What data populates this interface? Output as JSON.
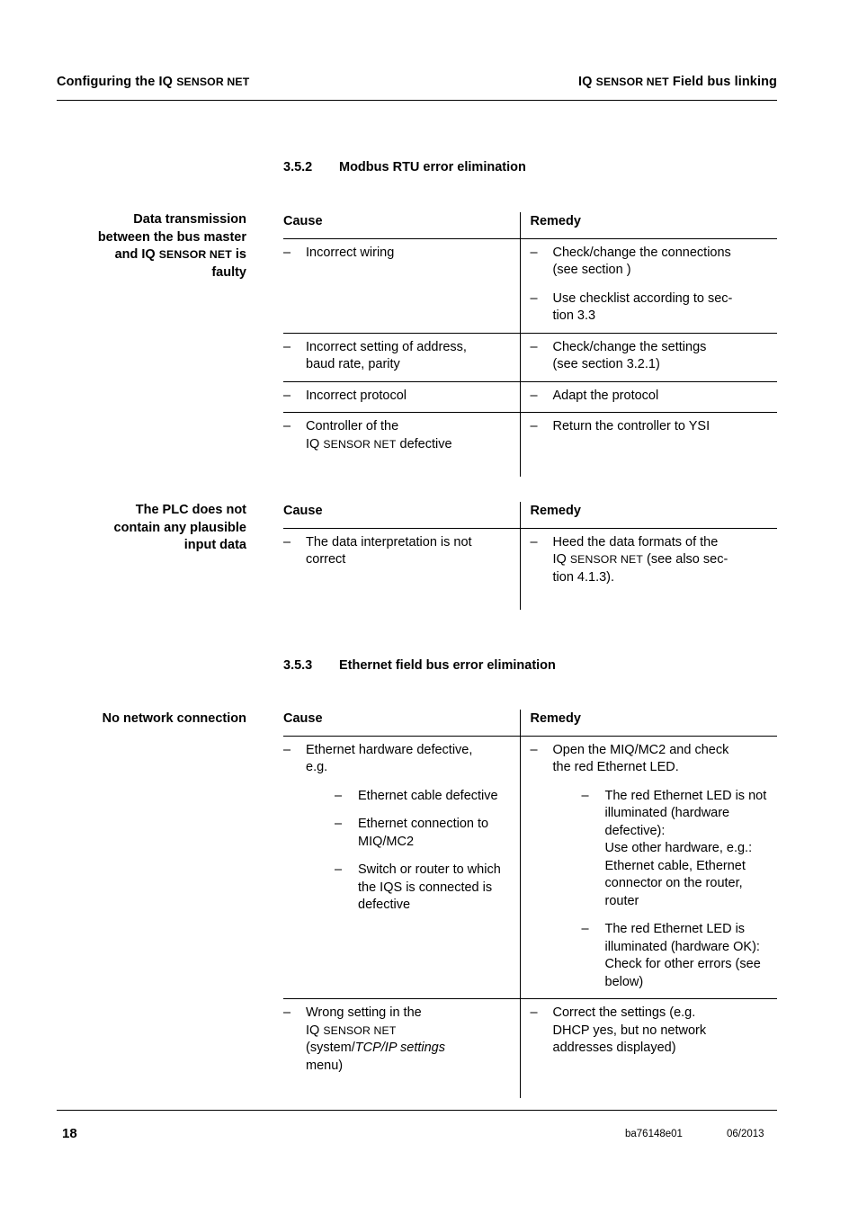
{
  "header": {
    "left_pre": "Configuring the IQ ",
    "left_sc": "SENSOR NET",
    "right_pre": "IQ ",
    "right_sc": "SENSOR NET",
    "right_post": " Field bus linking"
  },
  "footer": {
    "page_number": "18",
    "doc_id": "ba76148e01",
    "date": "06/2013"
  },
  "sections": [
    {
      "number": "3.5.2",
      "title": "Modbus RTU error elimination"
    },
    {
      "number": "3.5.3",
      "title": "Ethernet field bus error elimination"
    }
  ],
  "margin_labels": {
    "modbus_faulty_l1": "Data transmission",
    "modbus_faulty_l2": "between the bus master",
    "modbus_faulty_l3_pre": "and IQ ",
    "modbus_faulty_l3_sc": "SENSOR NET",
    "modbus_faulty_l3_post": " is",
    "modbus_faulty_l4": "faulty",
    "plc_l1": "The PLC does not",
    "plc_l2": "contain any plausible",
    "plc_l3": "input data",
    "no_network": "No network connection"
  },
  "table_headers": {
    "cause": "Cause",
    "remedy": "Remedy"
  },
  "table_modbus": {
    "rows": [
      {
        "cause": [
          "Incorrect wiring"
        ],
        "remedy_1_a": "Check/change the connections",
        "remedy_1_b": "(see section )",
        "remedy_2_a": "Use checklist according to sec-",
        "remedy_2_b": "tion 3.3"
      },
      {
        "cause_a": "Incorrect setting of address,",
        "cause_b": "baud rate, parity",
        "remedy_a": "Check/change the settings",
        "remedy_b": "(see section 3.2.1)"
      },
      {
        "cause": "Incorrect protocol",
        "remedy": "Adapt the protocol"
      },
      {
        "cause_a": "Controller of the",
        "cause_b_pre": "IQ ",
        "cause_b_sc": "SENSOR NET",
        "cause_b_post": " defective",
        "remedy": "Return the controller to YSI"
      }
    ]
  },
  "table_plc": {
    "rows": [
      {
        "cause_a": "The data interpretation is not",
        "cause_b": "correct",
        "remedy_a": "Heed the data formats of the",
        "remedy_b_pre": "IQ ",
        "remedy_b_sc": "SENSOR NET",
        "remedy_b_post": " (see also sec-",
        "remedy_c": "tion 4.1.3)."
      }
    ]
  },
  "table_ethernet": {
    "rows": [
      {
        "cause_main_a": "Ethernet hardware defective,",
        "cause_main_b": "e.g.",
        "cause_sub": [
          "Ethernet cable defective",
          "Ethernet connection to MIQ/MC2",
          "Switch or router to which the IQS is connected is defective"
        ],
        "remedy_main_a": "Open the MIQ/MC2 and check",
        "remedy_main_b": "the red Ethernet LED.",
        "remedy_sub": [
          "The red Ethernet LED is not illuminated (hardware defective):\nUse other hardware, e.g.: Ethernet cable, Ethernet connector on the router, router",
          "The red Ethernet LED is illuminated (hardware OK): Check for other errors (see below)"
        ]
      },
      {
        "cause_a": "Wrong setting in the",
        "cause_b_pre": "IQ ",
        "cause_b_sc": "SENSOR NET",
        "cause_c_pre": "(system/",
        "cause_c_ital": "TCP/IP settings",
        "cause_d": "menu)",
        "remedy_a": "Correct the settings (e.g.",
        "remedy_b": "DHCP yes, but no network",
        "remedy_c": "addresses displayed)"
      }
    ]
  }
}
